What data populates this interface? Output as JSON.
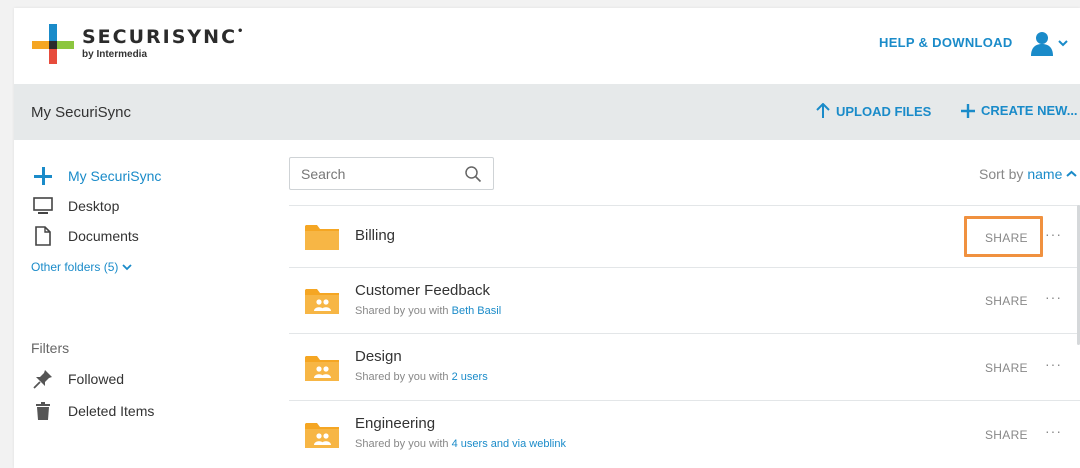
{
  "header": {
    "logo_text": "SECURISYNC",
    "logo_mark": "•",
    "logo_sub": "by Intermedia",
    "help_link": "HELP & DOWNLOAD"
  },
  "subheader": {
    "title": "My SecuriSync",
    "upload_label": "UPLOAD FILES",
    "create_label": "CREATE NEW..."
  },
  "sidebar": {
    "items": [
      {
        "label": "My SecuriSync",
        "icon": "securisync-plus-icon"
      },
      {
        "label": "Desktop",
        "icon": "monitor-icon"
      },
      {
        "label": "Documents",
        "icon": "document-icon"
      }
    ],
    "other_folders": "Other folders (5)",
    "filters_title": "Filters",
    "filters": [
      {
        "label": "Followed",
        "icon": "pin-icon"
      },
      {
        "label": "Deleted Items",
        "icon": "trash-icon"
      }
    ]
  },
  "search": {
    "placeholder": "Search"
  },
  "sort": {
    "prefix": "Sort by",
    "key": "name"
  },
  "folders": [
    {
      "name": "Billing",
      "shared_prefix": "",
      "shared_link": "",
      "share_label": "SHARE",
      "more": "···"
    },
    {
      "name": "Customer Feedback",
      "shared_prefix": "Shared by you with",
      "shared_link": "Beth Basil",
      "share_label": "SHARE",
      "more": "···"
    },
    {
      "name": "Design",
      "shared_prefix": "Shared by you with",
      "shared_link": "2 users",
      "share_label": "SHARE",
      "more": "···"
    },
    {
      "name": "Engineering",
      "shared_prefix": "Shared by you with",
      "shared_link": "4 users and via weblink",
      "share_label": "SHARE",
      "more": "···"
    }
  ],
  "colors": {
    "accent": "#1a8bc9",
    "highlight": "#f0913f",
    "folder": "#f5a623"
  }
}
